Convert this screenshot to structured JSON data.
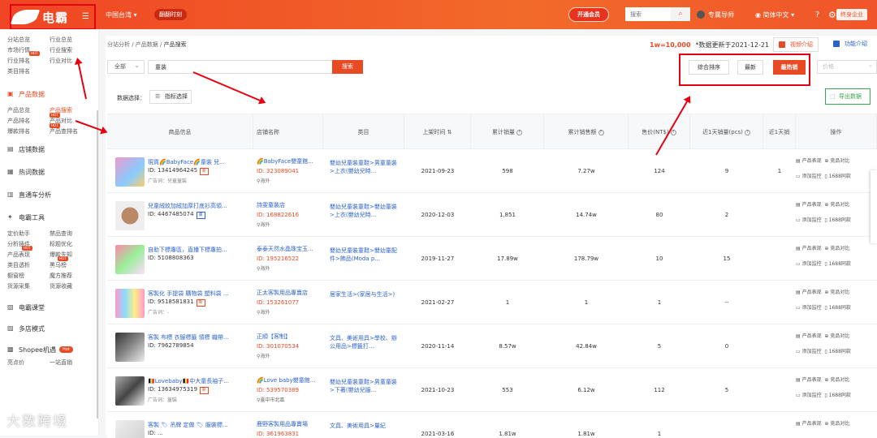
{
  "header": {
    "brand": "电霸",
    "region": "中国台湾 ▾",
    "badge": "翻翻时刻",
    "trial": "开通会员",
    "search_placeholder": "搜索",
    "user": "专属导师",
    "lang": "简体中文",
    "help": "?",
    "org": "终身企业"
  },
  "sidebar": {
    "top_grid": [
      [
        "分站总览",
        "行业总览"
      ],
      [
        "市场行情",
        "行业搜索"
      ],
      [
        "行业排名",
        "行业对比"
      ],
      [
        "类目排名",
        ""
      ]
    ],
    "product_section": "产品数据",
    "product_grid": [
      [
        "产品总览",
        "产品搜索"
      ],
      [
        "产品排名",
        "产品对比"
      ],
      [
        "爆款排名",
        "产品查排名"
      ]
    ],
    "sections1": [
      "店铺数据",
      "热词数据",
      "直通车分析"
    ],
    "tools_section": "电霸工具",
    "tools_grid": [
      [
        "定价助手",
        "禁品查询"
      ],
      [
        "分析插件",
        "标题优化"
      ],
      [
        "产品表现",
        "爆款先知"
      ],
      [
        "类目透析",
        "黑马榜"
      ],
      [
        "橱窗榜",
        "魔方推荐"
      ],
      [
        "货源采集",
        "货源收藏"
      ]
    ],
    "sections2": [
      "电霸课堂",
      "多店模式"
    ],
    "shopee": "Shopee机遇",
    "shopee_tag": "Hot",
    "bottom": [
      "亮点价",
      "一站直销"
    ]
  },
  "main": {
    "breadcrumb_prefix": "分站分析 / 产品数据 / ",
    "breadcrumb_current": "产品搜索",
    "rate": "1w=10,000",
    "updated": "*数据更新于2021-12-21",
    "video": "视频介绍",
    "func": "功能介绍",
    "cat_select": "全部",
    "keyword": "童装",
    "search_btn": "搜索",
    "sort": [
      "综合排序",
      "最新",
      "最热销"
    ],
    "price_placeholder": "价格",
    "data_select": "数据选择：",
    "metric_btn": "指标选择",
    "export": "导出数据",
    "columns": [
      "商品信息",
      "店铺名称",
      "类目",
      "上架时间",
      "累计销量",
      "累计销售额",
      "售价(NT$)",
      "近1天销量(pcs)",
      "近1天销",
      "操作"
    ],
    "ops": [
      "产品表现",
      "竞品对比",
      "添加监控",
      "1688同款"
    ],
    "rows": [
      {
        "title": "現貨🌈BabyFace🌈童裝 兒...",
        "id": "ID: 13414964245",
        "tag": "新",
        "ad": "广告词：兒童童裝",
        "store": "🌈BabyFace嬰童館...",
        "sid": "ID: 323089041",
        "loc": "海外",
        "cat": "嬰幼兒童裝童鞋>男童童裝>上衣(嬰幼兒時...",
        "date": "2021-09-23",
        "sales": "598",
        "revenue": "7.27w",
        "price": "124",
        "day": "9",
        "day2": "1"
      },
      {
        "title": "兒童絨紋加絨加厚打底衫高領...",
        "id": "ID: 4467485074",
        "tag": "賣",
        "ad": "",
        "store": "詩雯童裝店",
        "sid": "ID: 168822616",
        "loc": "海外",
        "cat": "嬰幼兒童裝童鞋>嬰幼童裝>上衣(嬰幼兒時...",
        "date": "2020-12-03",
        "sales": "1,851",
        "revenue": "14.74w",
        "price": "80",
        "day": "2",
        "day2": ""
      },
      {
        "title": "自助下標專區，直播下標專拍...",
        "id": "ID: 5108808363",
        "tag": "",
        "ad": "",
        "store": "泰泰天然水晶珠宝玉...",
        "sid": "ID: 195216522",
        "loc": "海外",
        "cat": "嬰幼兒童裝童鞋>嬰幼童配件>飾品(Moda p...",
        "date": "2019-11-27",
        "sales": "17.89w",
        "revenue": "178.79w",
        "price": "10",
        "day": "15",
        "day2": ""
      },
      {
        "title": "客製化 手提袋 購物袋 塑料袋 ...",
        "id": "ID: 9518581831",
        "tag": "新",
        "ad": "广告词：-",
        "store": "正太客製用品專賣店",
        "sid": "ID: 153261077",
        "loc": "海外",
        "cat": "居家生活>(家居与生活>)",
        "date": "2021-02-27",
        "sales": "1",
        "revenue": "1",
        "price": "1",
        "day": "--",
        "day2": ""
      },
      {
        "title": "客製 布標 衣服標籤 領標 織帶...",
        "id": "ID: 7962789854",
        "tag": "",
        "ad": "",
        "store": "正順【客制】",
        "sid": "ID: 301070534",
        "loc": "海外",
        "cat": "文具、美術用具>學校、辦公用品>標籤打...",
        "date": "2020-11-14",
        "sales": "8.57w",
        "revenue": "42.84w",
        "price": "5",
        "day": "0",
        "day2": ""
      },
      {
        "title": "🇧🇪Lovebaby🇧🇪中大童長袖子...",
        "id": "ID: 13634975319",
        "tag": "新",
        "ad": "广告词：童裝",
        "store": "🌈Love baby嬰童館...",
        "sid": "ID: 539570389",
        "loc": "臺中市北區",
        "cat": "嬰幼兒童裝童鞋>男童童裝>下著(嬰幼兒服...",
        "date": "2021-10-23",
        "sales": "553",
        "revenue": "6.12w",
        "price": "112",
        "day": "5",
        "day2": ""
      },
      {
        "title": "客製 🏷 吊牌 定做 🏷 服裝標...",
        "id": "ID: ...",
        "tag": "",
        "ad": "",
        "store": "鹿野客製用品專賣場",
        "sid": "ID: 361963831",
        "loc": "",
        "cat": "文具、美術用具>量紀",
        "date": "2021-03-16",
        "sales": "1.81w",
        "revenue": "1.81w",
        "price": "1",
        "day": "",
        "day2": ""
      }
    ]
  },
  "watermark": "大数跨境"
}
